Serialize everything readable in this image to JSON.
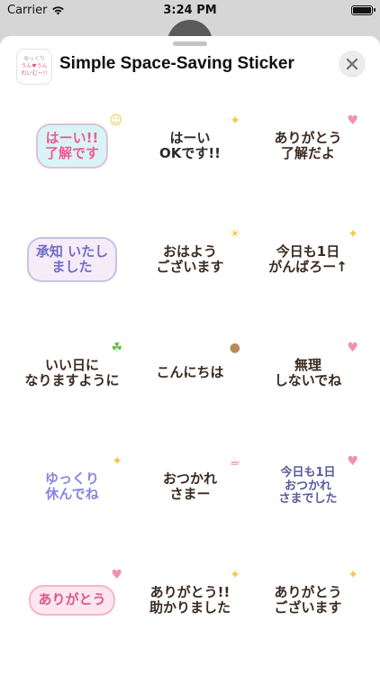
{
  "status_bar": {
    "carrier": "Carrier",
    "time": "3:24 PM"
  },
  "app": {
    "title": "Simple Space-Saving Sticker",
    "icon_text": [
      "ゆっくり",
      "うん♥うん",
      "れいむー!!"
    ]
  },
  "colors": {
    "pink": "#f06a9a",
    "blue": "#4aa3d8",
    "brown": "#3a2a20",
    "purple": "#7e7bd6",
    "yellow": "#f7d046",
    "green": "#6aba4a"
  },
  "stickers": [
    {
      "id": "s1",
      "lines": [
        "はーい!!",
        "了解です"
      ],
      "color": "#ef5b91",
      "bg": "#d9f4f7",
      "deco": "smile-icon"
    },
    {
      "id": "s2",
      "lines": [
        "はーい",
        "OKです!!"
      ],
      "color": "#2a2a2a",
      "bg": "#ffffff",
      "deco": "sparkle-icon"
    },
    {
      "id": "s3",
      "lines": [
        "ありがとう",
        "了解だよ"
      ],
      "color": "#3a2a20",
      "bg": "#ffffff",
      "deco": "bunny-icon"
    },
    {
      "id": "s4",
      "lines": [
        "承知 いたし",
        "ました"
      ],
      "color": "#6f6cc8",
      "bg": "#f6ecf7",
      "deco": "speech-bubble-icon"
    },
    {
      "id": "s5",
      "lines": [
        "おはよう",
        "ございます"
      ],
      "color": "#3a2a20",
      "bg": "#ffffff",
      "deco": "sun-icon"
    },
    {
      "id": "s6",
      "lines": [
        "今日も1日",
        "がんばろー↑"
      ],
      "color": "#3a2a20",
      "bg": "#ffffff",
      "deco": "star-icon"
    },
    {
      "id": "s7",
      "lines": [
        "いい日に",
        "なりますように"
      ],
      "color": "#3a2a20",
      "bg": "#ffffff",
      "deco": "clover-icon"
    },
    {
      "id": "s8",
      "lines": [
        "こんにちは"
      ],
      "color": "#3a2a20",
      "bg": "#ffffff",
      "deco": "bear-icon"
    },
    {
      "id": "s9",
      "lines": [
        "無理",
        "しないでね"
      ],
      "color": "#3a2a20",
      "bg": "#ffffff",
      "deco": "heart-icon"
    },
    {
      "id": "s10",
      "lines": [
        "ゆっくり",
        "休んでね"
      ],
      "color": "#8a86e0",
      "bg": "#ffffff",
      "deco": "sparkle-icon"
    },
    {
      "id": "s11",
      "lines": [
        "おつかれ",
        "さまー"
      ],
      "color": "#3a2a20",
      "bg": "#ffffff",
      "deco": "cup-icon"
    },
    {
      "id": "s12",
      "lines": [
        "今日も1日",
        "おつかれ",
        "さまでした"
      ],
      "color": "#5a5a9a",
      "bg": "#ffffff",
      "deco": "heart-icon"
    },
    {
      "id": "s13",
      "lines": [
        "ありがとう"
      ],
      "color": "#e0558a",
      "bg": "#fde6ef",
      "deco": "heart-icon"
    },
    {
      "id": "s14",
      "lines": [
        "ありがとう!!",
        "助かりました"
      ],
      "color": "#3a2a20",
      "bg": "#ffffff",
      "deco": "sparkle-icon"
    },
    {
      "id": "s15",
      "lines": [
        "ありがとう",
        "ございます"
      ],
      "color": "#3a2a20",
      "bg": "#ffffff",
      "deco": "sparkle-icon"
    }
  ]
}
